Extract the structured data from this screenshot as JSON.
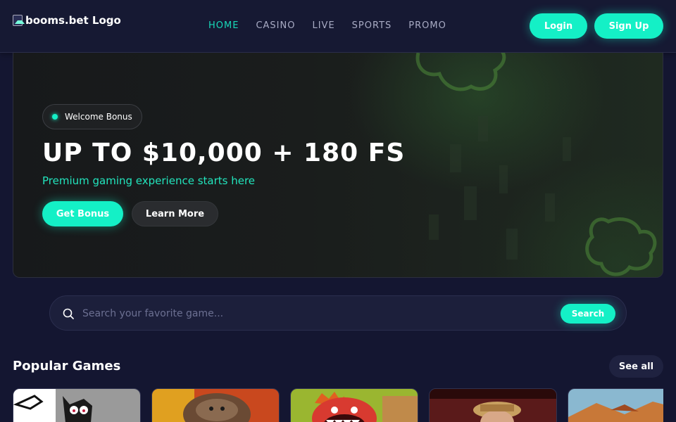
{
  "header": {
    "logo_alt": "booms.bet Logo",
    "nav": [
      {
        "label": "HOME",
        "active": true
      },
      {
        "label": "CASINO",
        "active": false
      },
      {
        "label": "LIVE",
        "active": false
      },
      {
        "label": "SPORTS",
        "active": false
      },
      {
        "label": "PROMO",
        "active": false
      }
    ],
    "login_label": "Login",
    "signup_label": "Sign Up"
  },
  "hero": {
    "badge": "Welcome Bonus",
    "title": "UP TO $10,000 + 180 FS",
    "subtitle": "Premium gaming experience starts here",
    "primary_button": "Get Bonus",
    "secondary_button": "Learn More"
  },
  "search": {
    "placeholder": "Search your favorite game...",
    "button_label": "Search"
  },
  "popular": {
    "title": "Popular Games",
    "see_all_label": "See all",
    "games": [
      {
        "icon": "cartoon-cat-thumbnail"
      },
      {
        "icon": "brown-creature-thumbnail"
      },
      {
        "icon": "red-monster-thumbnail"
      },
      {
        "icon": "cowboy-thumbnail"
      },
      {
        "icon": "desert-landscape-thumbnail"
      }
    ]
  },
  "colors": {
    "accent": "#14f0c6",
    "background": "#141631",
    "nav_active": "#18d9b8"
  }
}
